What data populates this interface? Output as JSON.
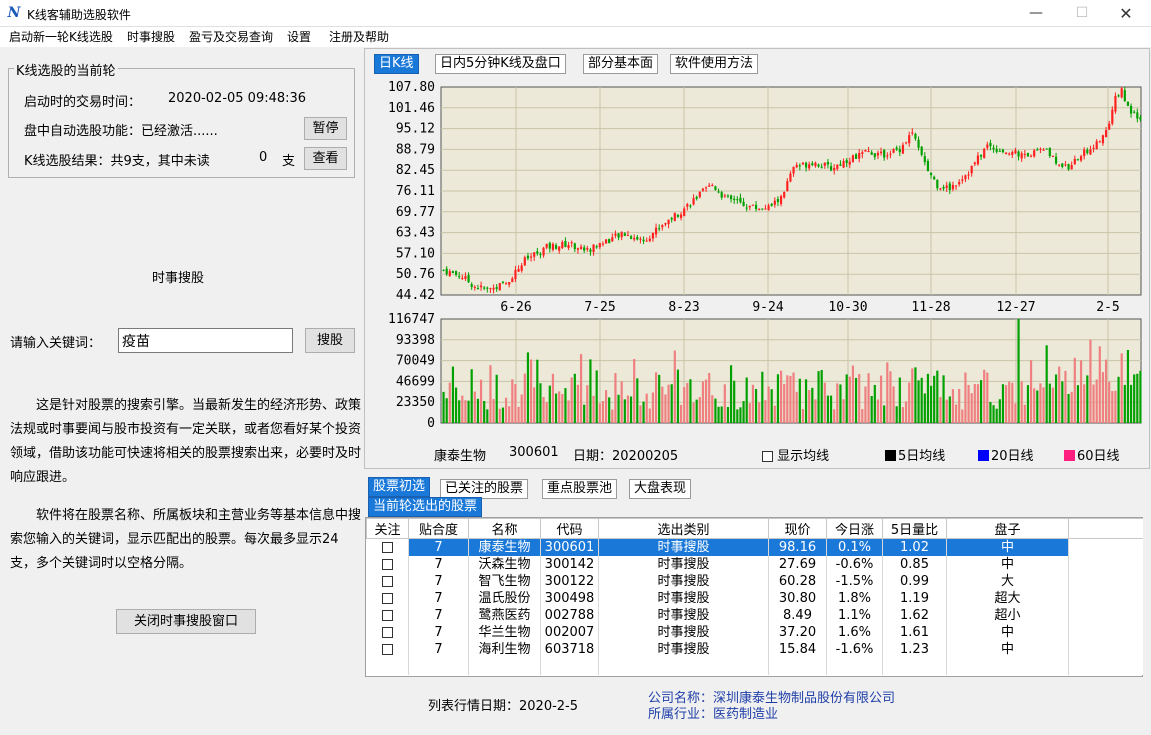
{
  "window": {
    "title": "K线客辅助选股软件",
    "icon": "app-logo-icon"
  },
  "menu": [
    "启动新一轮K线选股",
    "时事搜股",
    "盈亏及交易查询",
    "设置",
    "注册及帮助"
  ],
  "current_round": {
    "legend": "K线选股的当前轮",
    "start_label": "启动时的交易时间：",
    "start_time": "2020-02-05 09:48:36",
    "auto_label": "盘中自动选股功能：已经激活......",
    "pause_button": "暂停",
    "result_label": "K线选股结果：共9支，其中未读",
    "unread_count": "0",
    "unread_unit": "支",
    "view_button": "查看"
  },
  "news_search": {
    "heading": "时事搜股",
    "keyword_label": "请输入关键词：",
    "keyword_value": "疫苗",
    "search_button": "搜股",
    "description_1": "这是针对股票的搜索引擎。当最新发生的经济形势、政策法规或时事要闻与股市投资有一定关联，或者您看好某个投资领域，借助该功能可快速将相关的股票搜索出来，必要时及时响应跟进。",
    "description_2": "软件将在股票名称、所属板块和主营业务等基本信息中搜索您输入的关键词，显示匹配出的股票。每次最多显示24支，多个关键词时以空格分隔。",
    "close_button": "关闭时事搜股窗口"
  },
  "chart_tabs": [
    "日K线",
    "日内5分钟K线及盘口",
    "部分基本面",
    "软件使用方法"
  ],
  "chart_footer": {
    "stock_name": "康泰生物",
    "stock_code": "300601",
    "date_label": "日期：20200205",
    "show_ma_label": "显示均线",
    "ma_legend": [
      {
        "label": "5日均线",
        "color": "#000000"
      },
      {
        "label": "20日线",
        "color": "#0000ff"
      },
      {
        "label": "60日线",
        "color": "#ff1f7f"
      }
    ]
  },
  "chart_data": [
    {
      "type": "candlestick",
      "price_ticks": [
        "107.80",
        "101.46",
        "95.12",
        "88.79",
        "82.45",
        "76.11",
        "69.77",
        "63.43",
        "57.10",
        "50.76",
        "44.42"
      ],
      "ylim": [
        44.42,
        107.8
      ],
      "x_ticks": [
        "6-26",
        "7-25",
        "8-23",
        "9-24",
        "10-30",
        "11-28",
        "12-27",
        "2-5"
      ],
      "up_color": "#ff2020",
      "down_color": "#00a000",
      "close_path": [
        [
          0,
          52
        ],
        [
          6,
          50
        ],
        [
          10,
          47
        ],
        [
          14,
          46
        ],
        [
          20,
          48
        ],
        [
          26,
          55
        ],
        [
          33,
          59
        ],
        [
          40,
          60
        ],
        [
          46,
          58
        ],
        [
          52,
          61
        ],
        [
          58,
          63
        ],
        [
          64,
          61
        ],
        [
          70,
          66
        ],
        [
          76,
          70
        ],
        [
          82,
          75
        ],
        [
          86,
          78
        ],
        [
          90,
          74
        ],
        [
          96,
          72
        ],
        [
          100,
          71
        ],
        [
          104,
          71
        ],
        [
          108,
          74
        ],
        [
          112,
          83
        ],
        [
          118,
          85
        ],
        [
          124,
          83
        ],
        [
          130,
          86
        ],
        [
          136,
          88
        ],
        [
          140,
          87
        ],
        [
          146,
          89
        ],
        [
          150,
          94
        ],
        [
          154,
          84
        ],
        [
          158,
          78
        ],
        [
          162,
          77
        ],
        [
          168,
          82
        ],
        [
          174,
          90
        ],
        [
          180,
          88
        ],
        [
          186,
          87
        ],
        [
          192,
          89
        ],
        [
          196,
          85
        ],
        [
          200,
          83
        ],
        [
          204,
          87
        ],
        [
          208,
          90
        ],
        [
          212,
          94
        ],
        [
          215,
          104
        ],
        [
          217,
          108
        ],
        [
          219,
          101
        ],
        [
          221,
          99
        ],
        [
          223,
          97
        ]
      ]
    },
    {
      "type": "bar",
      "title": "volume",
      "ticks": [
        "116747",
        "93398",
        "70049",
        "46699",
        "23350",
        "0"
      ],
      "ylim": [
        0,
        116747
      ]
    }
  ],
  "stock_tabs": [
    "股票初选",
    "已关注的股票",
    "重点股票池",
    "大盘表现"
  ],
  "sub_tab": "当前轮选出的股票",
  "table": {
    "columns": [
      "关注",
      "贴合度",
      "名称",
      "代码",
      "选出类别",
      "现价",
      "今日涨",
      "5日量比",
      "盘子"
    ],
    "rows": [
      [
        "",
        "7",
        "康泰生物",
        "300601",
        "时事搜股",
        "98.16",
        "0.1%",
        "1.02",
        "中"
      ],
      [
        "",
        "7",
        "沃森生物",
        "300142",
        "时事搜股",
        "27.69",
        "-0.6%",
        "0.85",
        "中"
      ],
      [
        "",
        "7",
        "智飞生物",
        "300122",
        "时事搜股",
        "60.28",
        "-1.5%",
        "0.99",
        "大"
      ],
      [
        "",
        "7",
        "温氏股份",
        "300498",
        "时事搜股",
        "30.80",
        "1.8%",
        "1.19",
        "超大"
      ],
      [
        "",
        "7",
        "鹭燕医药",
        "002788",
        "时事搜股",
        "8.49",
        "1.1%",
        "1.62",
        "超小"
      ],
      [
        "",
        "7",
        "华兰生物",
        "002007",
        "时事搜股",
        "37.20",
        "1.6%",
        "1.61",
        "中"
      ],
      [
        "",
        "7",
        "海利生物",
        "603718",
        "时事搜股",
        "15.84",
        "-1.6%",
        "1.23",
        "中"
      ]
    ]
  },
  "footer": {
    "list_date": "列表行情日期：2020-2-5",
    "company": "公司名称：深圳康泰生物制品股份有限公司",
    "industry": "所属行业：医药制造业"
  }
}
